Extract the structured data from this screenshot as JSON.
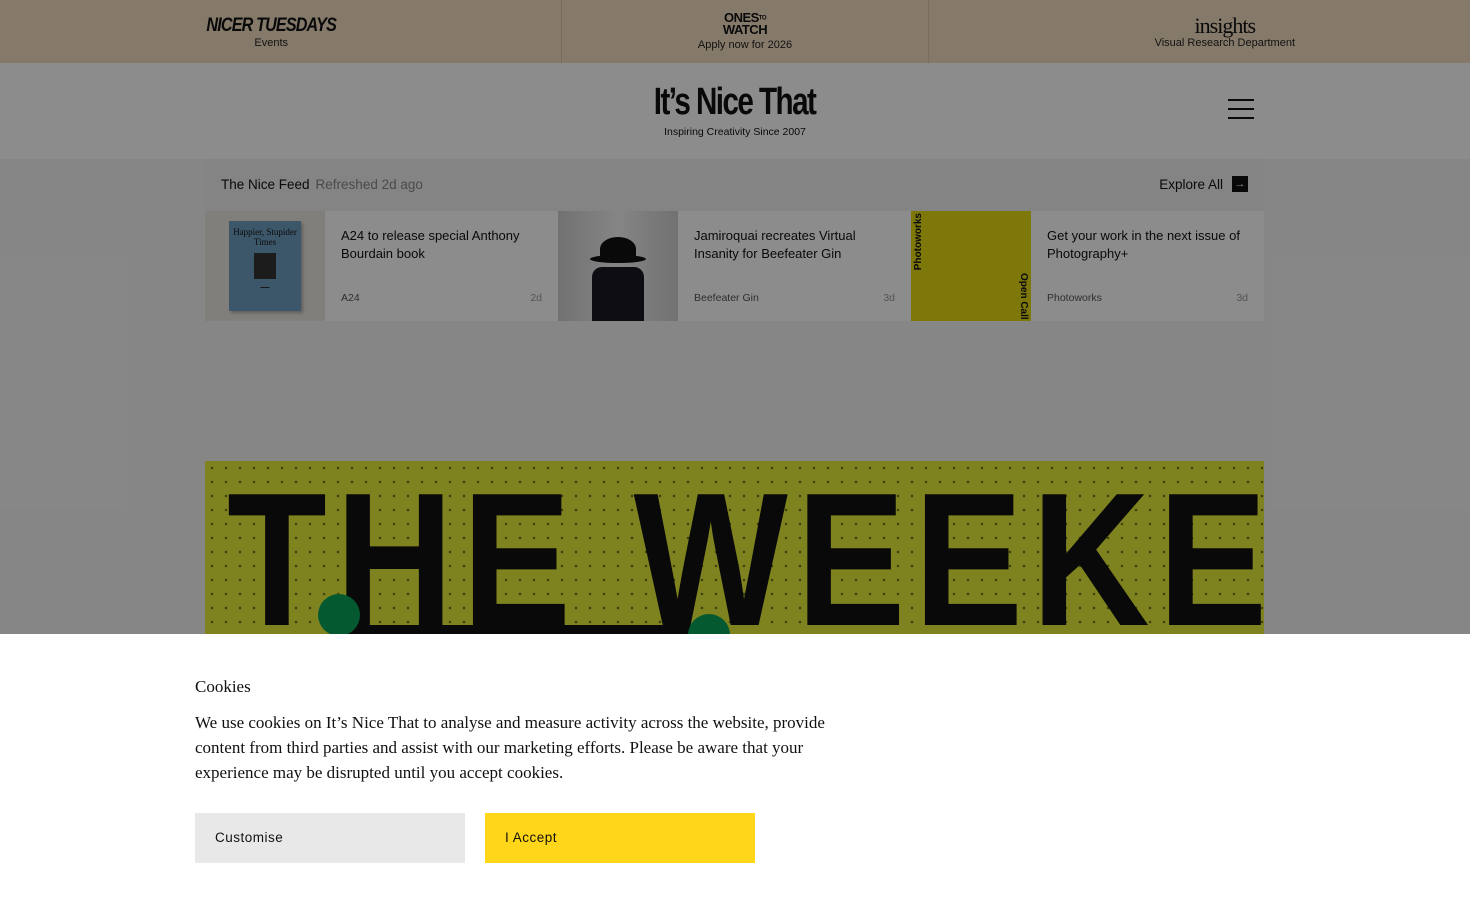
{
  "promo_bar": {
    "items": [
      {
        "logo": "NICER TUESDAYS",
        "subtitle": "Events"
      },
      {
        "logo_line1": "ONES",
        "logo_to": "TO",
        "logo_line2": "WATCH",
        "subtitle": "Apply now for 2026"
      },
      {
        "logo": "insights",
        "subtitle": "Visual Research Department"
      }
    ]
  },
  "header": {
    "brand": "It’s Nice That",
    "tagline": "Inspiring Creativity Since 2007",
    "menu_icon": "hamburger-icon"
  },
  "feed": {
    "title": "The Nice Feed",
    "refreshed": "Refreshed 2d ago",
    "explore_label": "Explore All",
    "explore_icon": "arrow-right-icon",
    "items": [
      {
        "title": "A24 to release special Anthony Bourdain book",
        "source": "A24",
        "age": "2d",
        "thumb_book_title": "Happier, Stupider Times"
      },
      {
        "title": "Jamiroquai recreates Virtual Insanity for Beefeater Gin",
        "source": "Beefeater Gin",
        "age": "3d"
      },
      {
        "title": "Get your work in the next issue of Photography+",
        "source": "Photoworks",
        "age": "3d",
        "thumb_text_1": "Photoworks",
        "thumb_text_2": "Open Call"
      }
    ]
  },
  "hero": {
    "title": "THE WEEKEND",
    "bg_color": "#e8ee3a",
    "accent_color": "#0aa35a"
  },
  "cookie_banner": {
    "title": "Cookies",
    "text": "We use cookies on It’s Nice That to analyse and measure activity across the website, provide content from third parties and assist with our marketing efforts. Please be aware that your experience may be disrupted until you accept cookies.",
    "customise_label": "Customise",
    "accept_label": "I Accept",
    "accept_color": "#ffd61a"
  }
}
